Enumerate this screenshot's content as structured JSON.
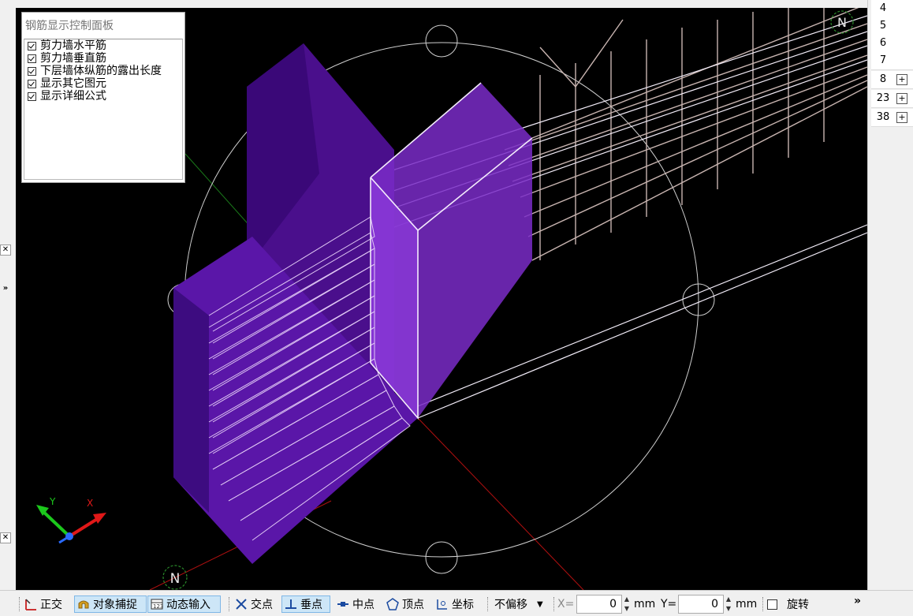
{
  "panel": {
    "title": "钢筋显示控制面板",
    "options": [
      {
        "label": "剪力墙水平筋",
        "checked": true
      },
      {
        "label": "剪力墙垂直筋",
        "checked": true
      },
      {
        "label": "下层墙体纵筋的露出长度",
        "checked": true
      },
      {
        "label": "显示其它图元",
        "checked": true
      },
      {
        "label": "显示详细公式",
        "checked": true
      }
    ]
  },
  "viewport": {
    "compass_label": "N",
    "axis_x": "X",
    "axis_y": "Y"
  },
  "right_list": [
    {
      "num": "4",
      "expand": false
    },
    {
      "num": "5",
      "expand": false
    },
    {
      "num": "6",
      "expand": false
    },
    {
      "num": "7",
      "expand": false
    },
    {
      "num": "8",
      "expand": true
    },
    {
      "num": "23",
      "expand": true
    },
    {
      "num": "38",
      "expand": true
    }
  ],
  "statusbar": {
    "ortho": "正交",
    "snap": "对象捕捉",
    "dynamic_input": "动态输入",
    "intersection": "交点",
    "perpendicular": "垂点",
    "midpoint": "中点",
    "vertex": "顶点",
    "coordinate": "坐标",
    "offset_mode": "不偏移",
    "x_label": "X=",
    "x_value": "0",
    "x_unit": "mm",
    "y_label": "Y=",
    "y_value": "0",
    "y_unit": "mm",
    "rotate": "旋转",
    "more": "»"
  },
  "left_more": "»",
  "close_glyph": "✕",
  "colors": {
    "wall_purple": "#5a16a8",
    "wall_light": "#9b4fd8",
    "rebar_white": "#e8d8f5",
    "rebar_tan": "#c8b4b0",
    "active_btn": "#cde6f7"
  }
}
